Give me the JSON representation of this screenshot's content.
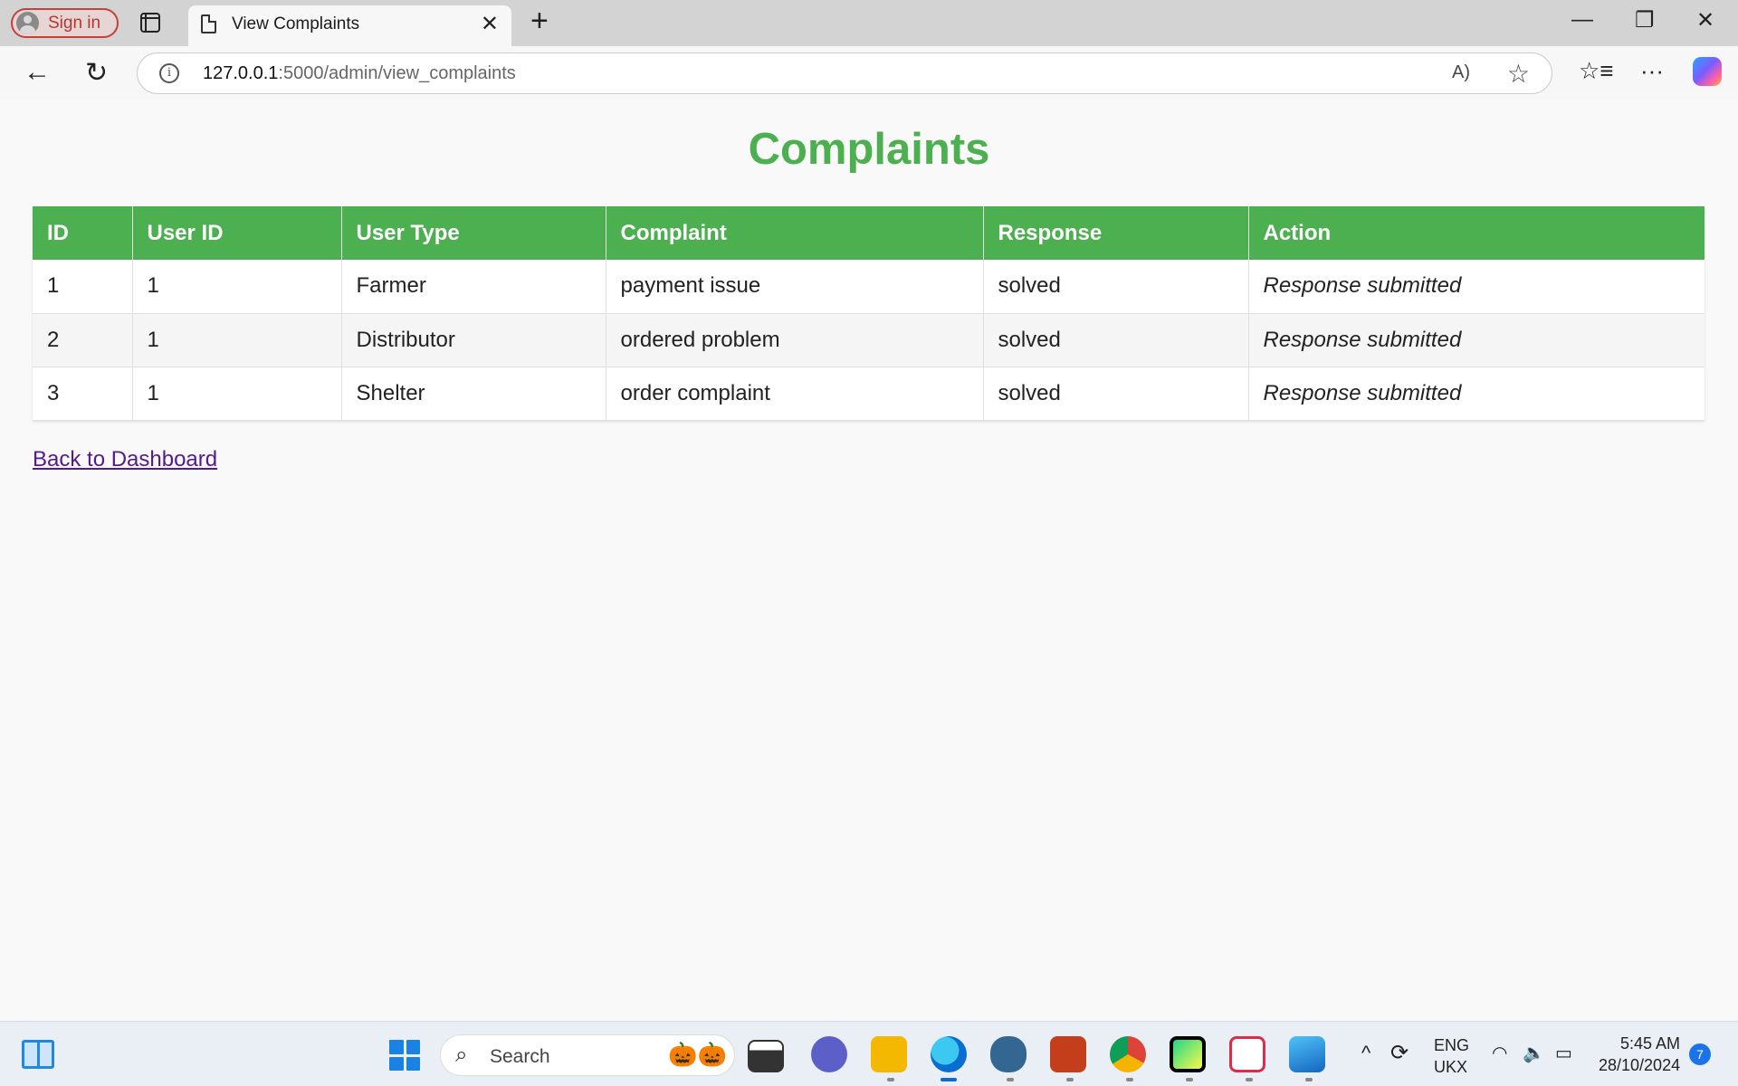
{
  "browser": {
    "sign_in_label": "Sign in",
    "tab_title": "View Complaints",
    "url_host": "127.0.0.1",
    "url_path": ":5000/admin/view_complaints"
  },
  "page": {
    "title": "Complaints",
    "columns": [
      "ID",
      "User ID",
      "User Type",
      "Complaint",
      "Response",
      "Action"
    ],
    "rows": [
      [
        "1",
        "1",
        "Farmer",
        "payment issue",
        "solved",
        "Response submitted"
      ],
      [
        "2",
        "1",
        "Distributor",
        "ordered problem",
        "solved",
        "Response submitted"
      ],
      [
        "3",
        "1",
        "Shelter",
        "order complaint",
        "solved",
        "Response submitted"
      ]
    ],
    "back_link": "Back to Dashboard",
    "accent_color": "#4caf50"
  },
  "taskbar": {
    "search_placeholder": "Search",
    "lang_top": "ENG",
    "lang_bottom": "UKX",
    "time": "5:45 AM",
    "date": "28/10/2024",
    "notification_count": "7"
  }
}
